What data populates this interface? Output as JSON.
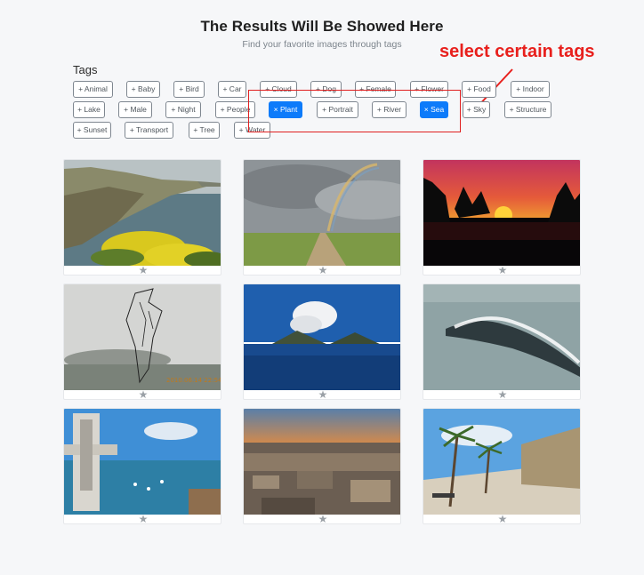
{
  "header": {
    "title": "The Results Will Be Showed Here",
    "subtitle": "Find your favorite images through tags"
  },
  "annotation": {
    "text": "select certain tags",
    "color": "#e8201d"
  },
  "tags": {
    "heading": "Tags",
    "items": [
      {
        "label": "+ Animal",
        "selected": false
      },
      {
        "label": "+ Baby",
        "selected": false
      },
      {
        "label": "+ Bird",
        "selected": false
      },
      {
        "label": "+ Car",
        "selected": false
      },
      {
        "label": "+ Cloud",
        "selected": false
      },
      {
        "label": "+ Dog",
        "selected": false
      },
      {
        "label": "+ Female",
        "selected": false
      },
      {
        "label": "+ Flower",
        "selected": false
      },
      {
        "label": "+ Food",
        "selected": false
      },
      {
        "label": "+ Indoor",
        "selected": false
      },
      {
        "label": "+ Lake",
        "selected": false
      },
      {
        "label": "+ Male",
        "selected": false
      },
      {
        "label": "+ Night",
        "selected": false
      },
      {
        "label": "+ People",
        "selected": false
      },
      {
        "label": "× Plant",
        "selected": true
      },
      {
        "label": "+ Portrait",
        "selected": false
      },
      {
        "label": "+ River",
        "selected": false
      },
      {
        "label": "× Sea",
        "selected": true
      },
      {
        "label": "+ Sky",
        "selected": false
      },
      {
        "label": "+ Structure",
        "selected": false
      },
      {
        "label": "+ Sunset",
        "selected": false
      },
      {
        "label": "+ Transport",
        "selected": false
      },
      {
        "label": "+ Tree",
        "selected": false
      },
      {
        "label": "+ Water",
        "selected": false
      }
    ],
    "selected_color": "#0d7bfa"
  },
  "results": {
    "images": [
      {
        "subject": "coastal cliffs with yellow flowers"
      },
      {
        "subject": "rainbow over grassy field"
      },
      {
        "subject": "sunset over water with palm silhouettes"
      },
      {
        "subject": "sketch drawing over misty coastline",
        "caption": "2010.06.14  22:54"
      },
      {
        "subject": "volcanic island smoke plume over sea"
      },
      {
        "subject": "island with cloud wave over sea"
      },
      {
        "subject": "harbor with elevator tower"
      },
      {
        "subject": "aerial city view at dusk"
      },
      {
        "subject": "palm-lined seaside promenade"
      }
    ],
    "favorite_icon": "star-icon"
  }
}
